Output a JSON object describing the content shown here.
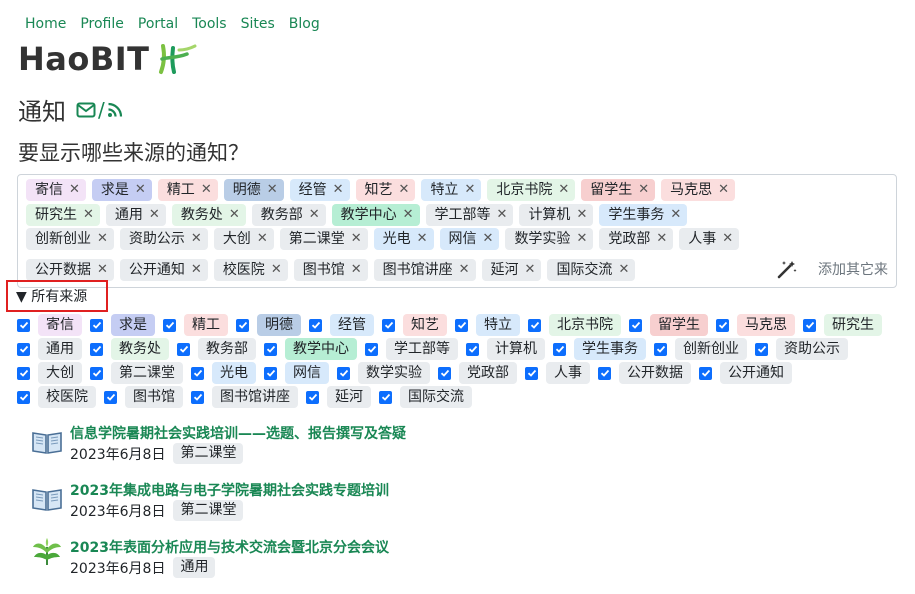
{
  "nav": [
    "Home",
    "Profile",
    "Portal",
    "Tools",
    "Sites",
    "Blog"
  ],
  "brand": "HaoBIT",
  "heading": "通知",
  "question": "要显示哪些来源的通知？",
  "colors": {
    "accent": "#198754",
    "checkbox": "#0d6efd",
    "purple": "#f3e3f7",
    "indigo": "#c5cdf3",
    "pink": "#fbdede",
    "steel": "#b9cde6",
    "skyblue": "#d7e9fb",
    "mint": "#e3f5e7",
    "rose": "#f7cfcf",
    "green": "#b6eed4",
    "gray": "#e9ecef"
  },
  "tag_rows": [
    [
      {
        "label": "寄信",
        "color": "#f3e3f7"
      },
      {
        "label": "求是",
        "color": "#c5cdf3"
      },
      {
        "label": "精工",
        "color": "#fbdede"
      },
      {
        "label": "明德",
        "color": "#b9cde6"
      },
      {
        "label": "经管",
        "color": "#d7e9fb"
      },
      {
        "label": "知艺",
        "color": "#fbdede"
      },
      {
        "label": "特立",
        "color": "#d7e9fb"
      },
      {
        "label": "北京书院",
        "color": "#e3f5e7"
      },
      {
        "label": "留学生",
        "color": "#f7cfcf"
      },
      {
        "label": "马克思",
        "color": "#fbdede"
      }
    ],
    [
      {
        "label": "研究生",
        "color": "#e3f5e7"
      },
      {
        "label": "通用",
        "color": "#e9ecef"
      },
      {
        "label": "教务处",
        "color": "#e3f5e7"
      },
      {
        "label": "教务部",
        "color": "#e9ecef"
      },
      {
        "label": "教学中心",
        "color": "#b6eed4"
      },
      {
        "label": "学工部等",
        "color": "#e9ecef"
      },
      {
        "label": "计算机",
        "color": "#e9ecef"
      },
      {
        "label": "学生事务",
        "color": "#d7e9fb"
      }
    ],
    [
      {
        "label": "创新创业",
        "color": "#e9ecef"
      },
      {
        "label": "资助公示",
        "color": "#e9ecef"
      },
      {
        "label": "大创",
        "color": "#e9ecef"
      },
      {
        "label": "第二课堂",
        "color": "#e9ecef"
      },
      {
        "label": "光电",
        "color": "#d7e9fb"
      },
      {
        "label": "网信",
        "color": "#d7e9fb"
      },
      {
        "label": "数学实验",
        "color": "#e9ecef"
      },
      {
        "label": "党政部",
        "color": "#e9ecef"
      },
      {
        "label": "人事",
        "color": "#e9ecef"
      }
    ],
    [
      {
        "label": "公开数据",
        "color": "#e9ecef"
      },
      {
        "label": "公开通知",
        "color": "#e9ecef"
      },
      {
        "label": "校医院",
        "color": "#e9ecef"
      },
      {
        "label": "图书馆",
        "color": "#e9ecef"
      },
      {
        "label": "图书馆讲座",
        "color": "#e9ecef"
      },
      {
        "label": "延河",
        "color": "#e9ecef"
      },
      {
        "label": "国际交流",
        "color": "#e9ecef"
      }
    ]
  ],
  "add_placeholder": "添加其它来",
  "details_label": "▼ 所有来源",
  "check_rows": [
    [
      {
        "label": "寄信",
        "color": "#f3e3f7"
      },
      {
        "label": "求是",
        "color": "#c5cdf3"
      },
      {
        "label": "精工",
        "color": "#fbdede"
      },
      {
        "label": "明德",
        "color": "#b9cde6"
      },
      {
        "label": "经管",
        "color": "#d7e9fb"
      },
      {
        "label": "知艺",
        "color": "#fbdede"
      },
      {
        "label": "特立",
        "color": "#d7e9fb"
      },
      {
        "label": "北京书院",
        "color": "#e3f5e7"
      },
      {
        "label": "留学生",
        "color": "#f7cfcf"
      },
      {
        "label": "马克思",
        "color": "#fbdede"
      },
      {
        "label": "研究生",
        "color": "#e3f5e7"
      }
    ],
    [
      {
        "label": "通用",
        "color": "#e9ecef"
      },
      {
        "label": "教务处",
        "color": "#e3f5e7"
      },
      {
        "label": "教务部",
        "color": "#e9ecef"
      },
      {
        "label": "教学中心",
        "color": "#b6eed4"
      },
      {
        "label": "学工部等",
        "color": "#e9ecef"
      },
      {
        "label": "计算机",
        "color": "#e9ecef"
      },
      {
        "label": "学生事务",
        "color": "#d7e9fb"
      },
      {
        "label": "创新创业",
        "color": "#e9ecef"
      },
      {
        "label": "资助公示",
        "color": "#e9ecef"
      }
    ],
    [
      {
        "label": "大创",
        "color": "#e9ecef"
      },
      {
        "label": "第二课堂",
        "color": "#e9ecef"
      },
      {
        "label": "光电",
        "color": "#d7e9fb"
      },
      {
        "label": "网信",
        "color": "#d7e9fb"
      },
      {
        "label": "数学实验",
        "color": "#e9ecef"
      },
      {
        "label": "党政部",
        "color": "#e9ecef"
      },
      {
        "label": "人事",
        "color": "#e9ecef"
      },
      {
        "label": "公开数据",
        "color": "#e9ecef"
      },
      {
        "label": "公开通知",
        "color": "#e9ecef"
      }
    ],
    [
      {
        "label": "校医院",
        "color": "#e9ecef"
      },
      {
        "label": "图书馆",
        "color": "#e9ecef"
      },
      {
        "label": "图书馆讲座",
        "color": "#e9ecef"
      },
      {
        "label": "延河",
        "color": "#e9ecef"
      },
      {
        "label": "国际交流",
        "color": "#e9ecef"
      }
    ]
  ],
  "posts": [
    {
      "title": "信息学院暑期社会实践培训——选题、报告撰写及答疑",
      "date": "2023年6月8日",
      "source": "第二课堂",
      "icon": "book-icon"
    },
    {
      "title": "2023年集成电路与电子学院暑期社会实践专题培训",
      "date": "2023年6月8日",
      "source": "第二课堂",
      "icon": "book-icon"
    },
    {
      "title": "2023年表面分析应用与技术交流会暨北京分会会议",
      "date": "2023年6月8日",
      "source": "通用",
      "icon": "leaf-icon"
    }
  ]
}
